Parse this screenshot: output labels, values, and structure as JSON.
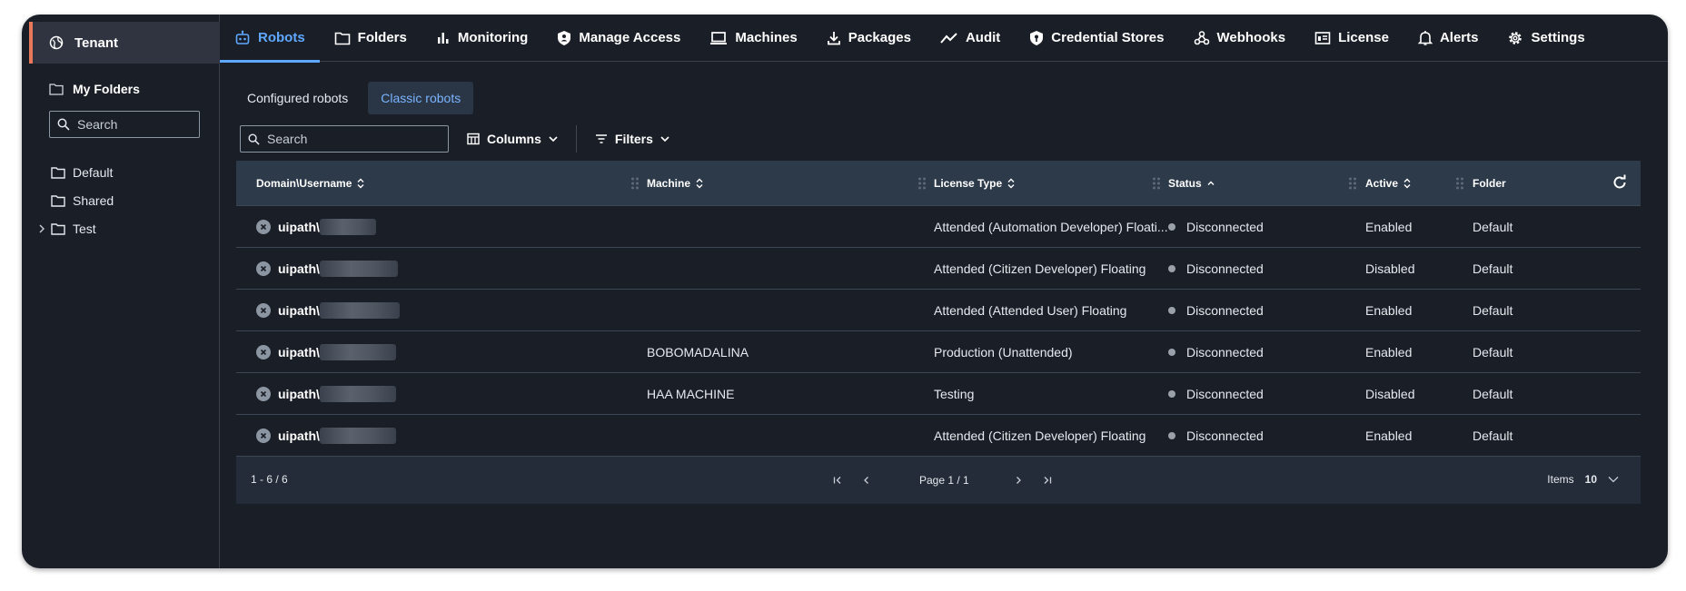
{
  "sidebar": {
    "tenant": "Tenant",
    "my_folders": "My Folders",
    "search_placeholder": "Search",
    "folders": [
      {
        "label": "Default",
        "expandable": false
      },
      {
        "label": "Shared",
        "expandable": false
      },
      {
        "label": "Test",
        "expandable": true
      }
    ]
  },
  "nav": {
    "tabs": [
      {
        "label": "Robots",
        "icon": "robot-icon",
        "active": true
      },
      {
        "label": "Folders",
        "icon": "folder-icon",
        "active": false
      },
      {
        "label": "Monitoring",
        "icon": "bar-chart-icon",
        "active": false
      },
      {
        "label": "Manage Access",
        "icon": "shield-user-icon",
        "active": false
      },
      {
        "label": "Machines",
        "icon": "laptop-icon",
        "active": false
      },
      {
        "label": "Packages",
        "icon": "download-icon",
        "active": false
      },
      {
        "label": "Audit",
        "icon": "trend-line-icon",
        "active": false
      },
      {
        "label": "Credential Stores",
        "icon": "shield-key-icon",
        "active": false
      },
      {
        "label": "Webhooks",
        "icon": "webhook-icon",
        "active": false
      },
      {
        "label": "License",
        "icon": "license-icon",
        "active": false
      },
      {
        "label": "Alerts",
        "icon": "bell-icon",
        "active": false
      },
      {
        "label": "Settings",
        "icon": "gear-icon",
        "active": false
      }
    ]
  },
  "subtabs": [
    {
      "label": "Configured robots",
      "active": false
    },
    {
      "label": "Classic robots",
      "active": true
    }
  ],
  "toolbar": {
    "search_placeholder": "Search",
    "columns_label": "Columns",
    "filters_label": "Filters"
  },
  "table": {
    "headers": {
      "username": "Domain\\Username",
      "machine": "Machine",
      "license_type": "License Type",
      "status": "Status",
      "active": "Active",
      "folder": "Folder"
    },
    "rows": [
      {
        "username": "uipath\\",
        "machine": "",
        "license_type": "Attended (Automation Developer) Floati...",
        "status": "Disconnected",
        "active": "Enabled",
        "folder": "Default"
      },
      {
        "username": "uipath\\",
        "machine": "",
        "license_type": "Attended (Citizen Developer) Floating",
        "status": "Disconnected",
        "active": "Disabled",
        "folder": "Default"
      },
      {
        "username": "uipath\\",
        "machine": "",
        "license_type": "Attended (Attended User) Floating",
        "status": "Disconnected",
        "active": "Enabled",
        "folder": "Default"
      },
      {
        "username": "uipath\\",
        "machine": "BOBOMADALINA",
        "license_type": "Production (Unattended)",
        "status": "Disconnected",
        "active": "Enabled",
        "folder": "Default"
      },
      {
        "username": "uipath\\",
        "machine": "HAA MACHINE",
        "license_type": "Testing",
        "status": "Disconnected",
        "active": "Disabled",
        "folder": "Default"
      },
      {
        "username": "uipath\\",
        "machine": "",
        "license_type": "Attended (Citizen Developer) Floating",
        "status": "Disconnected",
        "active": "Enabled",
        "folder": "Default"
      }
    ],
    "footer": {
      "range": "1 - 6 / 6",
      "page": "Page 1 / 1",
      "items_label": "Items",
      "items_value": "10"
    }
  },
  "colors": {
    "background": "#1a1f27",
    "accent": "#5fa8ff",
    "tenant_marker": "#e8785a",
    "header_bg": "#2c3a4a"
  }
}
